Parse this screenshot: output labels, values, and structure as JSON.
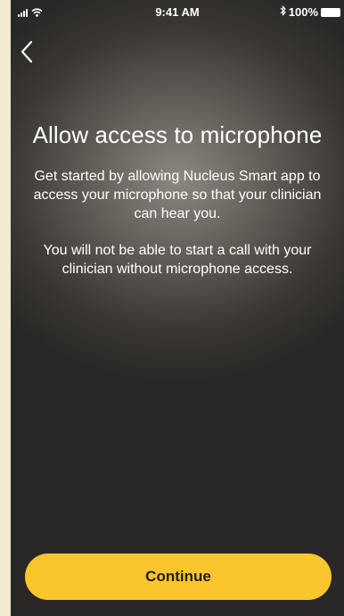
{
  "status_bar": {
    "time": "9:41 AM",
    "battery": "100%",
    "icons": [
      "signal-icon",
      "wifi-icon",
      "bluetooth-icon",
      "battery-icon"
    ]
  },
  "nav": {
    "back_icon": "chevron-left-icon"
  },
  "main": {
    "title": "Allow access to microphone",
    "paragraph_1": "Get started by allowing Nucleus Smart app to access your microphone so that your clinician can hear you.",
    "paragraph_2": "You will not be able to start a call with your clinician without microphone access."
  },
  "actions": {
    "continue_label": "Continue"
  },
  "colors": {
    "accent": "#fbc52e",
    "page_border": "#f2ead2",
    "text": "#ffffff"
  }
}
